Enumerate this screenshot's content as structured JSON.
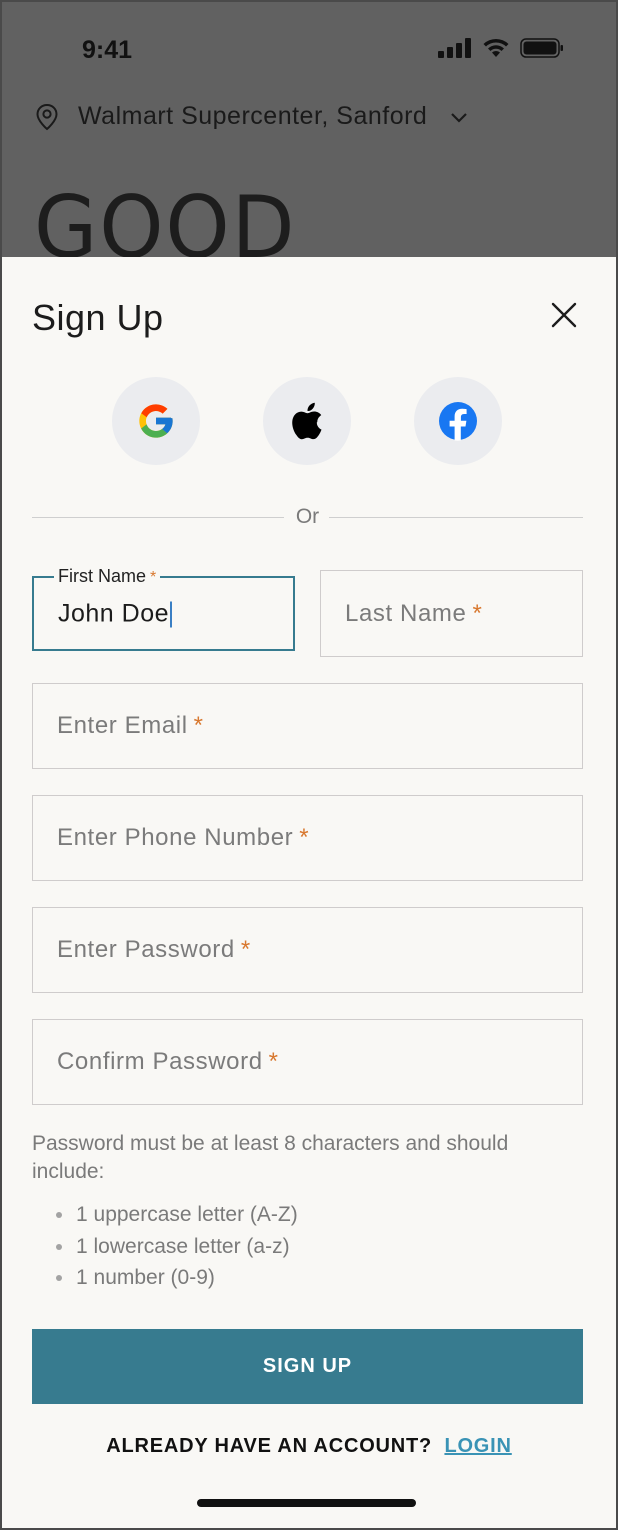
{
  "status_bar": {
    "time": "9:41"
  },
  "location": {
    "store": "Walmart Supercenter, Sanford"
  },
  "background_heading": "GOOD",
  "sheet": {
    "title": "Sign Up",
    "divider_text": "Or",
    "social": [
      {
        "name": "google-icon"
      },
      {
        "name": "apple-icon"
      },
      {
        "name": "facebook-icon"
      }
    ],
    "fields": {
      "first_name": {
        "label": "First Name",
        "value": "John Doe",
        "required": "*"
      },
      "last_name": {
        "placeholder": "Last Name",
        "required": "*"
      },
      "email": {
        "placeholder": "Enter Email",
        "required": "*"
      },
      "phone": {
        "placeholder": "Enter Phone Number",
        "required": "*"
      },
      "password": {
        "placeholder": "Enter Password",
        "required": "*"
      },
      "confirm_password": {
        "placeholder": "Confirm Password",
        "required": "*"
      }
    },
    "password_help": "Password must be at least 8 characters and should include:",
    "password_rules": [
      "1 uppercase letter (A-Z)",
      "1 lowercase letter (a-z)",
      "1 number (0-9)"
    ],
    "signup_label": "SIGN UP",
    "login_prompt": "ALREADY HAVE AN ACCOUNT?",
    "login_link": "LOGIN"
  },
  "colors": {
    "accent": "#377b8f",
    "link": "#3a93b5",
    "required": "#d8782f",
    "overlay": "#616161",
    "sheet_bg": "#f9f8f5"
  }
}
